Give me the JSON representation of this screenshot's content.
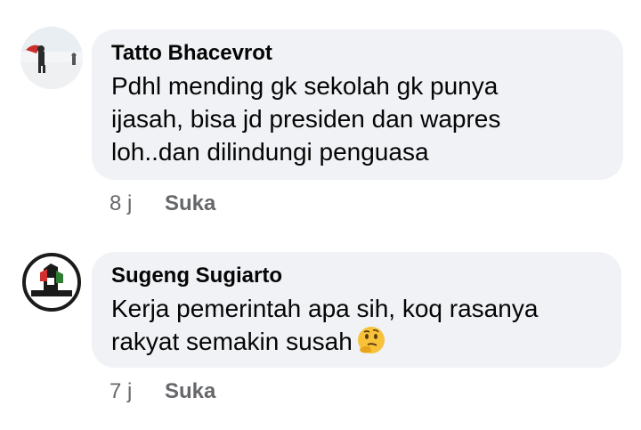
{
  "comments": [
    {
      "author": "Tatto Bhacevrot",
      "lines": [
        "Pdhl mending gk sekolah gk punya",
        "ijasah, bisa jd presiden dan wapres",
        "loh..dan dilindungi penguasa"
      ],
      "time": "8 j",
      "like_label": "Suka",
      "avatar_icon": "beach-photo-avatar"
    },
    {
      "author": "Sugeng Sugiarto",
      "lines": [
        "Kerja pemerintah apa sih, koq rasanya",
        "rakyat semakin susah"
      ],
      "emoji": "thinking-face-emoji",
      "time": "7 j",
      "like_label": "Suka",
      "avatar_icon": "free-palestine-badge-avatar",
      "avatar_caption": "FREE PALESTINE"
    }
  ],
  "colors": {
    "bubble": "#f0f2f5",
    "text": "#050505",
    "meta": "#65676b"
  }
}
